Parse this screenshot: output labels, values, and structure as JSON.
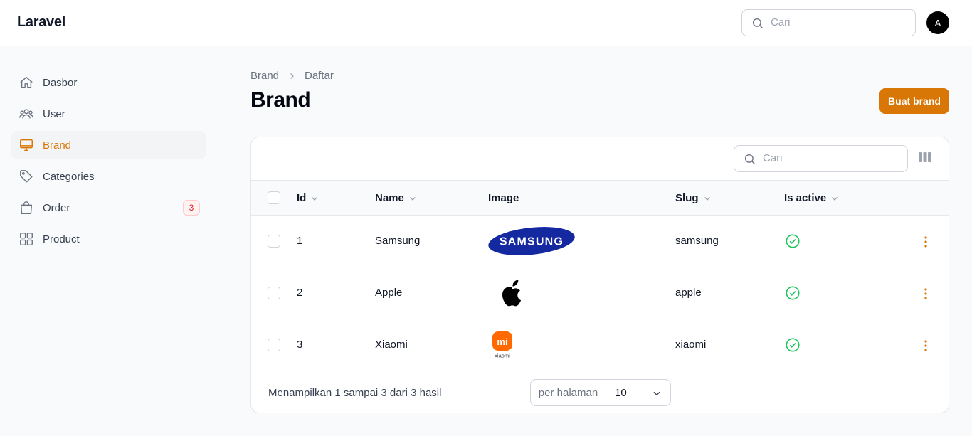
{
  "app": {
    "title": "Laravel"
  },
  "topbar": {
    "search_placeholder": "Cari",
    "avatar_initial": "A"
  },
  "sidebar": {
    "items": [
      {
        "label": "Dasbor",
        "icon": "home-icon"
      },
      {
        "label": "User",
        "icon": "users-icon"
      },
      {
        "label": "Brand",
        "icon": "computer-desktop-icon",
        "active": true
      },
      {
        "label": "Categories",
        "icon": "tag-icon"
      },
      {
        "label": "Order",
        "icon": "shopping-bag-icon",
        "badge": "3"
      },
      {
        "label": "Product",
        "icon": "squares-icon"
      }
    ]
  },
  "breadcrumb": {
    "items": [
      "Brand",
      "Daftar"
    ]
  },
  "page": {
    "title": "Brand",
    "create_button": "Buat brand"
  },
  "table": {
    "search_placeholder": "Cari",
    "columns": [
      "Id",
      "Name",
      "Image",
      "Slug",
      "Is active"
    ],
    "rows": [
      {
        "id": "1",
        "name": "Samsung",
        "image": "samsung-logo",
        "slug": "samsung",
        "active": true
      },
      {
        "id": "2",
        "name": "Apple",
        "image": "apple-logo",
        "slug": "apple",
        "active": true
      },
      {
        "id": "3",
        "name": "Xiaomi",
        "image": "xiaomi-logo",
        "slug": "xiaomi",
        "active": true
      }
    ],
    "logo_text": {
      "samsung": "SAMSUNG",
      "xiaomi_mark": "mi",
      "xiaomi_word": "xiaomi"
    },
    "footer_text": "Menampilkan 1 sampai 3 dari 3 hasil",
    "per_page_label": "per halaman",
    "per_page_value": "10"
  },
  "colors": {
    "accent": "#d97706",
    "success": "#22c55e",
    "badge": "#dc2626",
    "xiaomi": "#ff6900",
    "samsung": "#1428a0"
  }
}
